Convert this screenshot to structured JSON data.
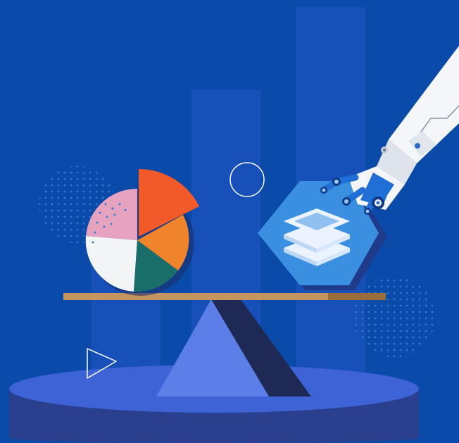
{
  "illustration": {
    "theme": "balance scale comparing a pie chart and a data-layers icon, with a robotic hand",
    "colors": {
      "background": "#0a4aa8",
      "bar_column": "#1650b8",
      "platform_top": "#3e63d6",
      "platform_side": "#2b3f8f",
      "fulcrum": "#5b7fe6",
      "fulcrum_shadow": "#1e2a55",
      "beam": "#c4955f",
      "beam_dark": "#9a6c3a",
      "pie_orange_red": "#f25a2a",
      "pie_orange": "#f0842c",
      "pie_teal": "#1a6e6a",
      "pie_white": "#f2f4f6",
      "pie_pink": "#e6a3bf",
      "hexagon": "#3a8fe0",
      "hexagon_shadow": "#1f3b8a",
      "robot_white": "#f4f6fa",
      "robot_blue": "#1f6fd6",
      "dots": "#2f7fd8"
    },
    "icons": [
      "pie-chart-icon",
      "layers-icon",
      "robot-hand-icon",
      "play-triangle-icon",
      "circle-outline-icon"
    ]
  }
}
